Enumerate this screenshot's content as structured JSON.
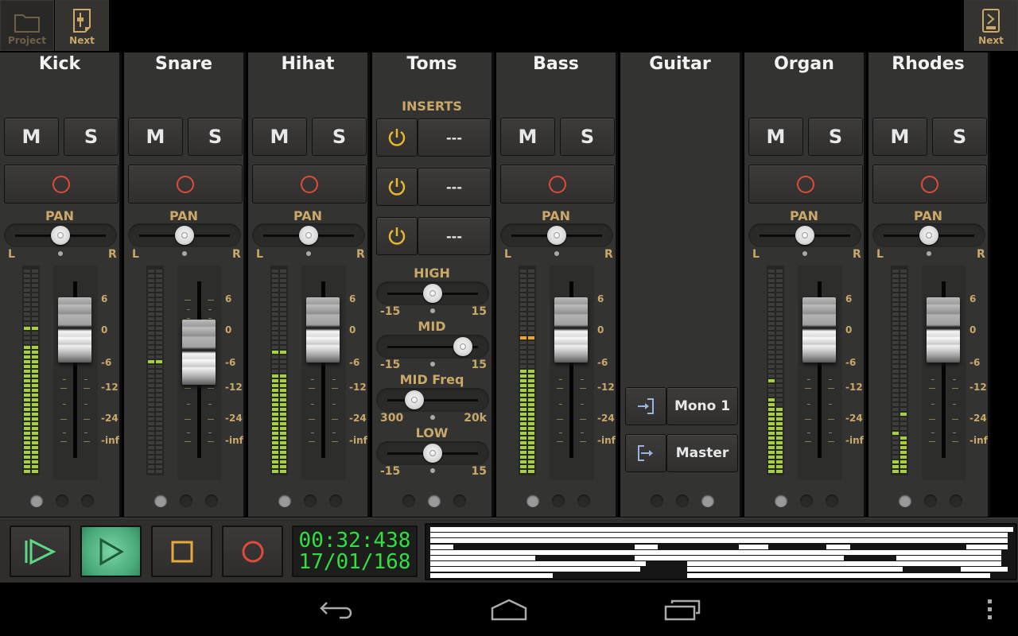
{
  "topbar": {
    "left_buttons": [
      {
        "label": "Project",
        "icon": "folder-icon",
        "active": false
      },
      {
        "label": "Next",
        "icon": "mixer-page-icon",
        "active": true
      }
    ],
    "right_button": {
      "label": "Next",
      "icon": "next-page-icon"
    }
  },
  "colors": {
    "accent_gold": "#c9a86a",
    "record_red": "#e04a3a",
    "meter_green": "#a6d13a",
    "meter_peak": "#f0a820",
    "clock_green": "#2fe040",
    "play_active": "#5cbf8a",
    "stop_orange": "#e8a83a",
    "route_blue": "#9ab4e0"
  },
  "labels": {
    "mute": "M",
    "solo": "S",
    "pan": "PAN",
    "pan_left": "L",
    "pan_right": "R",
    "db_scale": [
      "6",
      "0",
      "-6",
      "-12",
      "-24",
      "-inf"
    ]
  },
  "channels": [
    {
      "name": "Kick",
      "type": "track",
      "pan": 0.5,
      "fader_db": 0,
      "meter_l": 0.62,
      "meter_r": 0.62,
      "peak_l": 0.7,
      "peak_r": 0.7,
      "led": 0
    },
    {
      "name": "Snare",
      "type": "track",
      "pan": 0.5,
      "fader_db": -4,
      "meter_l": 0,
      "meter_r": 0,
      "peak_l": 0.54,
      "peak_r": 0.54,
      "led": 0
    },
    {
      "name": "Hihat",
      "type": "track",
      "pan": 0.5,
      "fader_db": 0,
      "meter_l": 0.49,
      "meter_r": 0.49,
      "peak_l": 0.59,
      "peak_r": 0.59,
      "led": 0
    },
    {
      "name": "Toms",
      "type": "inserts",
      "led": 1
    },
    {
      "name": "Bass",
      "type": "track",
      "pan": 0.5,
      "fader_db": 0,
      "meter_l": 0.51,
      "meter_r": 0.51,
      "peak_l": 0.66,
      "peak_r": 0.64,
      "peak_color": "orange",
      "led": 0
    },
    {
      "name": "Guitar",
      "type": "routing",
      "led": 2
    },
    {
      "name": "Organ",
      "type": "track",
      "pan": 0.5,
      "fader_db": 0,
      "meter_l": 0.37,
      "meter_r": 0.3,
      "peak_l": 0.44,
      "peak_r": 0.3,
      "led": 0
    },
    {
      "name": "Rhodes",
      "type": "track",
      "pan": 0.5,
      "fader_db": 0,
      "meter_l": 0.08,
      "meter_r": 0.19,
      "peak_l": 0.19,
      "peak_r": 0.27,
      "led": 0
    }
  ],
  "inserts": {
    "title": "INSERTS",
    "slots": [
      {
        "label": "---",
        "enabled": true
      },
      {
        "label": "---",
        "enabled": true
      },
      {
        "label": "---",
        "enabled": true
      }
    ]
  },
  "eq": [
    {
      "label": "HIGH",
      "min": "-15",
      "max": "15",
      "value": 0.5
    },
    {
      "label": "MID",
      "min": "-15",
      "max": "15",
      "value": 0.83
    },
    {
      "label": "MID Freq",
      "min": "300",
      "max": "20k",
      "value": 0.3
    },
    {
      "label": "LOW",
      "min": "-15",
      "max": "15",
      "value": 0.5
    }
  ],
  "routing": {
    "input": {
      "label": "Mono 1",
      "icon": "input-icon"
    },
    "output": {
      "label": "Master",
      "icon": "output-icon"
    }
  },
  "transport": {
    "buttons": [
      {
        "name": "return-to-start-button",
        "icon": "return-to-start-icon"
      },
      {
        "name": "play-button",
        "icon": "play-icon",
        "active": true
      },
      {
        "name": "stop-button",
        "icon": "stop-icon"
      },
      {
        "name": "record-button",
        "icon": "record-icon"
      }
    ],
    "time": "00:32:438",
    "bars": "17/01/168"
  },
  "overview_rows": [
    [
      [
        0,
        1.0
      ]
    ],
    [
      [
        0,
        0.99
      ]
    ],
    [
      [
        0,
        0.99
      ]
    ],
    [
      [
        0,
        0.04
      ],
      [
        0.35,
        0.39
      ],
      [
        0.53,
        0.58
      ],
      [
        0.68,
        0.72
      ],
      [
        0.92,
        0.99
      ]
    ],
    [
      [
        0,
        0.98
      ]
    ],
    [
      [
        0,
        0.18
      ],
      [
        0.35,
        0.71
      ],
      [
        0.8,
        0.98
      ]
    ],
    [
      [
        0,
        0.37
      ],
      [
        0.44,
        0.98
      ]
    ],
    [
      [
        0,
        0.36
      ],
      [
        0.44,
        0.81
      ],
      [
        0.91,
        0.99
      ]
    ],
    [
      [
        0,
        0.21
      ],
      [
        0.44,
        0.96
      ]
    ]
  ],
  "navbar": {
    "items": [
      {
        "name": "back-button",
        "icon": "back-icon"
      },
      {
        "name": "home-button",
        "icon": "home-icon"
      },
      {
        "name": "recent-apps-button",
        "icon": "recent-apps-icon"
      },
      {
        "name": "overflow-menu-button",
        "icon": "overflow-menu-icon"
      }
    ]
  }
}
